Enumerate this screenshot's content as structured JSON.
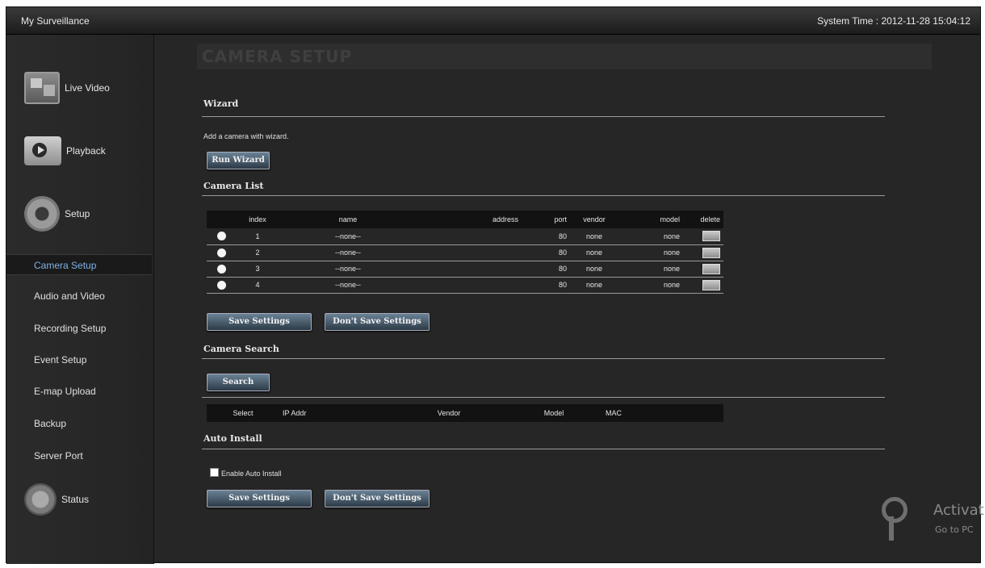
{
  "window": {
    "app_title": "My Surveillance",
    "system_time": "System Time : 2012-11-28 15:04:12"
  },
  "sidebar": {
    "main": [
      {
        "label": "Live Video",
        "icon": "live-video-icon"
      },
      {
        "label": "Playback",
        "icon": "playback-icon"
      },
      {
        "label": "Setup",
        "icon": "gear-icon"
      },
      {
        "label": "Status",
        "icon": "status-icon"
      }
    ],
    "setup_items": [
      {
        "label": "Camera Setup",
        "active": true
      },
      {
        "label": "Audio and Video"
      },
      {
        "label": "Recording Setup"
      },
      {
        "label": "Event Setup"
      },
      {
        "label": "E-map Upload"
      },
      {
        "label": "Backup"
      },
      {
        "label": "Server Port"
      }
    ]
  },
  "page": {
    "title": "CAMERA SETUP",
    "wizard": {
      "title": "Wizard",
      "hint": "Add a camera with wizard.",
      "run_label": "Run Wizard"
    },
    "camera_list": {
      "title": "Camera List",
      "columns": [
        "index",
        "name",
        "address",
        "port",
        "vendor",
        "model",
        "delete"
      ],
      "rows": [
        {
          "index": "1",
          "name": "--none--",
          "address": "",
          "port": "80",
          "vendor": "none",
          "model": "none"
        },
        {
          "index": "2",
          "name": "--none--",
          "address": "",
          "port": "80",
          "vendor": "none",
          "model": "none"
        },
        {
          "index": "3",
          "name": "--none--",
          "address": "",
          "port": "80",
          "vendor": "none",
          "model": "none"
        },
        {
          "index": "4",
          "name": "--none--",
          "address": "",
          "port": "80",
          "vendor": "none",
          "model": "none"
        }
      ],
      "save_label": "Save Settings",
      "dont_save_label": "Don't Save Settings"
    },
    "camera_search": {
      "title": "Camera Search",
      "search_label": "Search",
      "columns": [
        "Select",
        "IP Addr",
        "Vendor",
        "Model",
        "MAC"
      ]
    },
    "auto_install": {
      "title": "Auto Install",
      "checkbox_label": "Enable Auto Install",
      "save_label": "Save Settings",
      "dont_save_label": "Don't Save Settings"
    }
  },
  "watermark": {
    "line1": "Activat",
    "line2": "Go to PC"
  },
  "colors": {
    "background": "#262626",
    "active_nav_text": "#7fb2e6",
    "button_top": "#6a8296",
    "button_bottom": "#2c3a46"
  }
}
